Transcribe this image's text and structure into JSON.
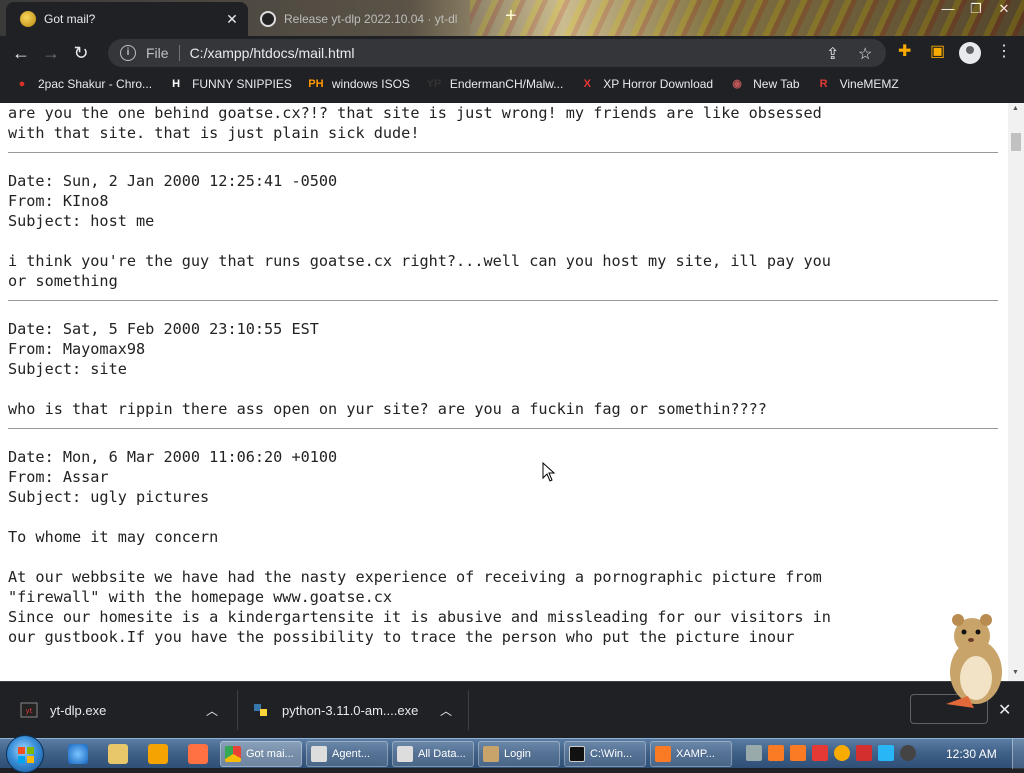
{
  "tabs": [
    {
      "title": "Got mail?",
      "active": true
    },
    {
      "title": "Release yt-dlp 2022.10.04 · yt-dl",
      "active": false
    }
  ],
  "window_controls": {
    "minimize": "—",
    "maximize": "❐",
    "close": "✕"
  },
  "toolbar": {
    "back": "←",
    "forward": "→",
    "reload": "↻",
    "scheme_label": "File",
    "url": "C:/xampp/htdocs/mail.html"
  },
  "bookmarks": [
    {
      "label": "2pac Shakur - Chro...",
      "icon": "chrome-icon",
      "color": "#d93025"
    },
    {
      "label": "FUNNY SNIPPIES",
      "icon": "H",
      "color": "#ffffff"
    },
    {
      "label": "windows ISOS",
      "icon": "PH",
      "color": "#ff9900"
    },
    {
      "label": "EndermanCH/Malw...",
      "icon": "YP",
      "color": "#333333"
    },
    {
      "label": "XP Horror Download",
      "icon": "X",
      "color": "#e53935"
    },
    {
      "label": "New Tab",
      "icon": "globe-icon",
      "color": "#b55"
    },
    {
      "label": "VineMEMZ",
      "icon": "R",
      "color": "#e53935"
    }
  ],
  "mail": {
    "intro": [
      "are you the one behind goatse.cx?!? that site is just wrong! my friends are like obsessed",
      "with that site. that is just plain sick dude!"
    ],
    "messages": [
      {
        "date": "Date: Sun, 2 Jan 2000 12:25:41 -0500",
        "from": "From: KIno8",
        "subject": "Subject: host me",
        "body": [
          "i think you're the guy that runs goatse.cx right?...well can you host my site, ill pay you",
          "or something"
        ]
      },
      {
        "date": "Date: Sat, 5 Feb 2000 23:10:55 EST",
        "from": "From: Mayomax98",
        "subject": "Subject: site",
        "body": [
          "who is that rippin there ass open on yur site? are you a fuckin fag or somethin????"
        ]
      },
      {
        "date": "Date: Mon, 6 Mar 2000 11:06:20 +0100",
        "from": "From: Assar",
        "subject": "Subject: ugly pictures",
        "body": [
          "To whome it may concern",
          "",
          "At our webbsite we have had the nasty experience of receiving a pornographic picture from",
          "\"firewall\" with the homepage www.goatse.cx",
          "Since our homesite is a kindergartensite it is abusive and missleading for our visitors in",
          "our gustbook.If you have the possibility to trace the person who put the picture inour"
        ]
      }
    ]
  },
  "downloads": [
    {
      "filename": "yt-dlp.exe"
    },
    {
      "filename": "python-3.11.0-am....exe"
    }
  ],
  "taskbar": {
    "tasks": [
      {
        "label": "Got mai...",
        "active": true
      },
      {
        "label": "Agent...",
        "active": false
      },
      {
        "label": "All Data...",
        "active": false
      },
      {
        "label": "Login",
        "active": false
      },
      {
        "label": "C:\\Win...",
        "active": false
      },
      {
        "label": "XAMP...",
        "active": false
      }
    ],
    "clock": "12:30 AM"
  }
}
